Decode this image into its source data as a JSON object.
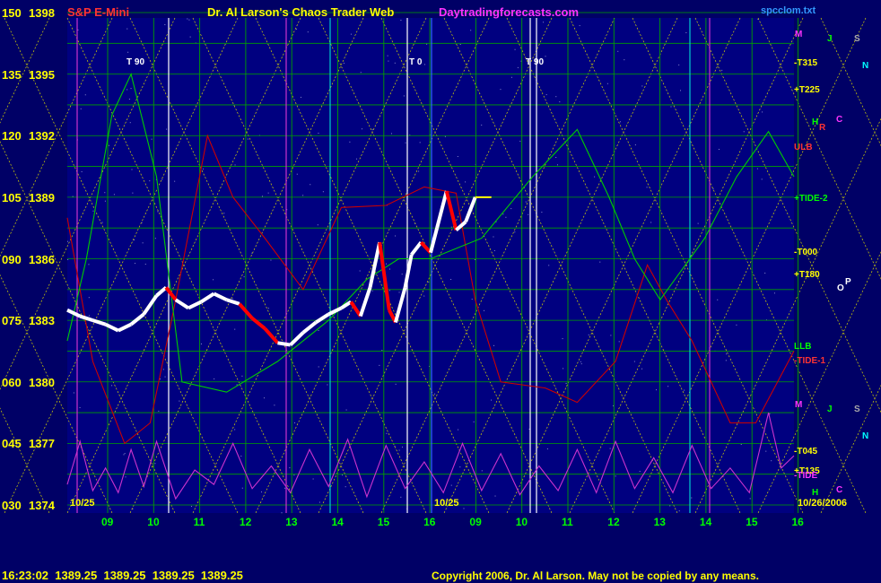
{
  "header": {
    "symbol": "S&P E-Mini",
    "title": "Dr. Al Larson's Chaos Trader Web",
    "site": "Daytradingforecasts.com",
    "file": "spcclom.txt"
  },
  "footer": {
    "quote": "16:23:02  1389.25  1389.25  1389.25  1389.25",
    "copyright": "Copyright 2006, Dr. Al Larson. May not be copied by any means."
  },
  "colors": {
    "background": "#000066",
    "plot_bg": "#000080",
    "grid_green": "#00a000",
    "fib_yellow": "#d8d800",
    "price_white": "#ffffff",
    "price_red": "#ff0000",
    "tide_red": "#cc0000",
    "tide_green": "#00cc00",
    "osc_magenta": "#cc33cc",
    "header_red": "#ff3333",
    "header_magenta": "#ff33ff",
    "axis_yellow": "#ffff00",
    "axis_green": "#00ff00"
  },
  "chart_data": {
    "type": "line",
    "y_labels": [
      {
        "left": "150",
        "price": "1398"
      },
      {
        "left": "135",
        "price": "1395"
      },
      {
        "left": "120",
        "price": "1392"
      },
      {
        "left": "105",
        "price": "1389"
      },
      {
        "left": "090",
        "price": "1386"
      },
      {
        "left": "075",
        "price": "1383"
      },
      {
        "left": "060",
        "price": "1380"
      },
      {
        "left": "045",
        "price": "1377"
      },
      {
        "left": "030",
        "price": "1374"
      }
    ],
    "ylim": [
      1374,
      1398
    ],
    "x_hours": [
      "09",
      "10",
      "11",
      "12",
      "13",
      "14",
      "15",
      "16",
      "09",
      "10",
      "11",
      "12",
      "13",
      "14",
      "15",
      "16"
    ],
    "date_labels": [
      "10/25",
      "10/25",
      "10/26/2006"
    ],
    "right_labels": [
      "-T315",
      "+T225",
      "ULB",
      "+TIDE-2",
      "-T000",
      "+T180",
      "LLB",
      "-TIDE-1",
      "-T045",
      "+T135",
      "-TIDE"
    ],
    "planet_letters_right": [
      "M",
      "J",
      "S",
      "N",
      "H",
      "C",
      "R",
      "O",
      "P",
      "M",
      "J",
      "S",
      "N",
      "H",
      "C"
    ],
    "markers_top": [
      "T 90",
      "T 0",
      "T 90"
    ],
    "series": [
      {
        "style": "price-bars",
        "points": [
          [
            0,
            1383.5
          ],
          [
            2,
            1383.2
          ],
          [
            4,
            1383.0
          ],
          [
            6,
            1382.8
          ],
          [
            8,
            1382.5
          ],
          [
            10,
            1382.8
          ],
          [
            12,
            1383.3
          ],
          [
            14,
            1384.2
          ],
          [
            15.5,
            1384.6
          ],
          [
            17,
            1384.0
          ],
          [
            19,
            1383.6
          ],
          [
            21,
            1383.9
          ],
          [
            23,
            1384.3
          ],
          [
            25,
            1384.0
          ],
          [
            27,
            1383.8
          ],
          [
            29,
            1383.1
          ],
          [
            31,
            1382.6
          ],
          [
            33,
            1381.9
          ],
          [
            35,
            1381.8
          ],
          [
            37,
            1382.4
          ],
          [
            39,
            1382.9
          ],
          [
            41,
            1383.3
          ],
          [
            43,
            1383.6
          ],
          [
            44.5,
            1383.9
          ],
          [
            46,
            1383.2
          ],
          [
            47.5,
            1384.6
          ],
          [
            49,
            1386.8
          ],
          [
            50.5,
            1383.5
          ],
          [
            51.5,
            1382.9
          ],
          [
            53,
            1384.6
          ],
          [
            54,
            1386.2
          ],
          [
            55.5,
            1386.8
          ],
          [
            57,
            1386.3
          ],
          [
            58,
            1387.5
          ],
          [
            59.5,
            1389.3
          ],
          [
            61,
            1387.4
          ],
          [
            62.5,
            1387.8
          ],
          [
            64,
            1389.0
          ]
        ]
      },
      {
        "style": "green-cycle",
        "points": [
          [
            0,
            1382
          ],
          [
            3,
            1386
          ],
          [
            7,
            1393
          ],
          [
            10,
            1395
          ],
          [
            14,
            1390
          ],
          [
            18,
            1380
          ],
          [
            25,
            1379.5
          ],
          [
            33,
            1381
          ],
          [
            41,
            1383
          ],
          [
            47,
            1385
          ],
          [
            52,
            1386
          ],
          [
            57,
            1386
          ],
          [
            65,
            1387
          ],
          [
            73,
            1390
          ],
          [
            80,
            1392.3
          ],
          [
            85,
            1389
          ],
          [
            89,
            1386
          ],
          [
            93,
            1384
          ],
          [
            100,
            1387
          ],
          [
            105,
            1390
          ],
          [
            110,
            1392.2
          ],
          [
            114,
            1390
          ]
        ]
      },
      {
        "style": "red-cycle",
        "points": [
          [
            0,
            1388
          ],
          [
            4,
            1381
          ],
          [
            9,
            1377
          ],
          [
            13,
            1378
          ],
          [
            17,
            1384
          ],
          [
            22,
            1392
          ],
          [
            26,
            1389
          ],
          [
            31,
            1387
          ],
          [
            37,
            1384.5
          ],
          [
            43,
            1388.5
          ],
          [
            50,
            1388.6
          ],
          [
            56,
            1389.5
          ],
          [
            61,
            1389.2
          ],
          [
            64,
            1384
          ],
          [
            68,
            1380
          ],
          [
            75,
            1379.7
          ],
          [
            80,
            1379
          ],
          [
            86,
            1381
          ],
          [
            91,
            1385.7
          ],
          [
            94,
            1384
          ],
          [
            98,
            1382
          ],
          [
            104,
            1378
          ],
          [
            108,
            1378
          ],
          [
            114,
            1381.5
          ]
        ]
      },
      {
        "style": "magenta-osc",
        "points": [
          [
            0,
            1375
          ],
          [
            2,
            1377.1
          ],
          [
            4,
            1374.7
          ],
          [
            6,
            1375.8
          ],
          [
            8,
            1374.6
          ],
          [
            10,
            1376.7
          ],
          [
            12,
            1374.9
          ],
          [
            14,
            1377.1
          ],
          [
            17,
            1374.3
          ],
          [
            20,
            1375.7
          ],
          [
            23,
            1375
          ],
          [
            26,
            1377
          ],
          [
            29,
            1374.8
          ],
          [
            32,
            1375.9
          ],
          [
            35,
            1374.6
          ],
          [
            38,
            1376.7
          ],
          [
            41,
            1374.9
          ],
          [
            44,
            1377.2
          ],
          [
            47,
            1374.4
          ],
          [
            50,
            1376.9
          ],
          [
            53,
            1374.8
          ],
          [
            56,
            1376.1
          ],
          [
            59,
            1374.6
          ],
          [
            62,
            1377
          ],
          [
            65,
            1374.7
          ],
          [
            68,
            1376.5
          ],
          [
            71,
            1374.5
          ],
          [
            74,
            1375.9
          ],
          [
            77,
            1374.7
          ],
          [
            80,
            1376.7
          ],
          [
            83,
            1374.6
          ],
          [
            86,
            1377.1
          ],
          [
            89,
            1374.8
          ],
          [
            92,
            1376.3
          ],
          [
            95,
            1374.6
          ],
          [
            98,
            1376.9
          ],
          [
            101,
            1374.8
          ],
          [
            104,
            1375.8
          ],
          [
            107,
            1374.6
          ],
          [
            110,
            1378.5
          ],
          [
            112,
            1375.8
          ],
          [
            114,
            1376.4
          ]
        ]
      }
    ],
    "grid": true,
    "legend": "none"
  }
}
